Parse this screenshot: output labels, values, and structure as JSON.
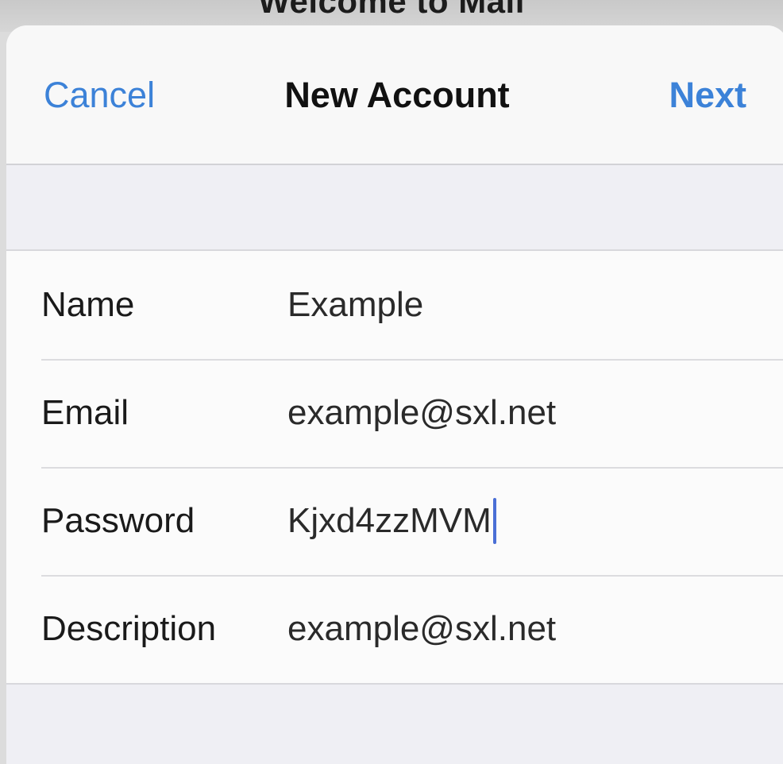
{
  "background": {
    "title": "Welcome to Mail"
  },
  "navbar": {
    "cancel_label": "Cancel",
    "title": "New Account",
    "next_label": "Next"
  },
  "form": {
    "rows": [
      {
        "label": "Name",
        "value": "Example"
      },
      {
        "label": "Email",
        "value": "example@sxl.net"
      },
      {
        "label": "Password",
        "value": "Kjxd4zzMVM"
      },
      {
        "label": "Description",
        "value": "example@sxl.net"
      }
    ]
  },
  "colors": {
    "accent": "#3c82d8",
    "caret": "#4a6fd6",
    "background": "#efeff4"
  }
}
